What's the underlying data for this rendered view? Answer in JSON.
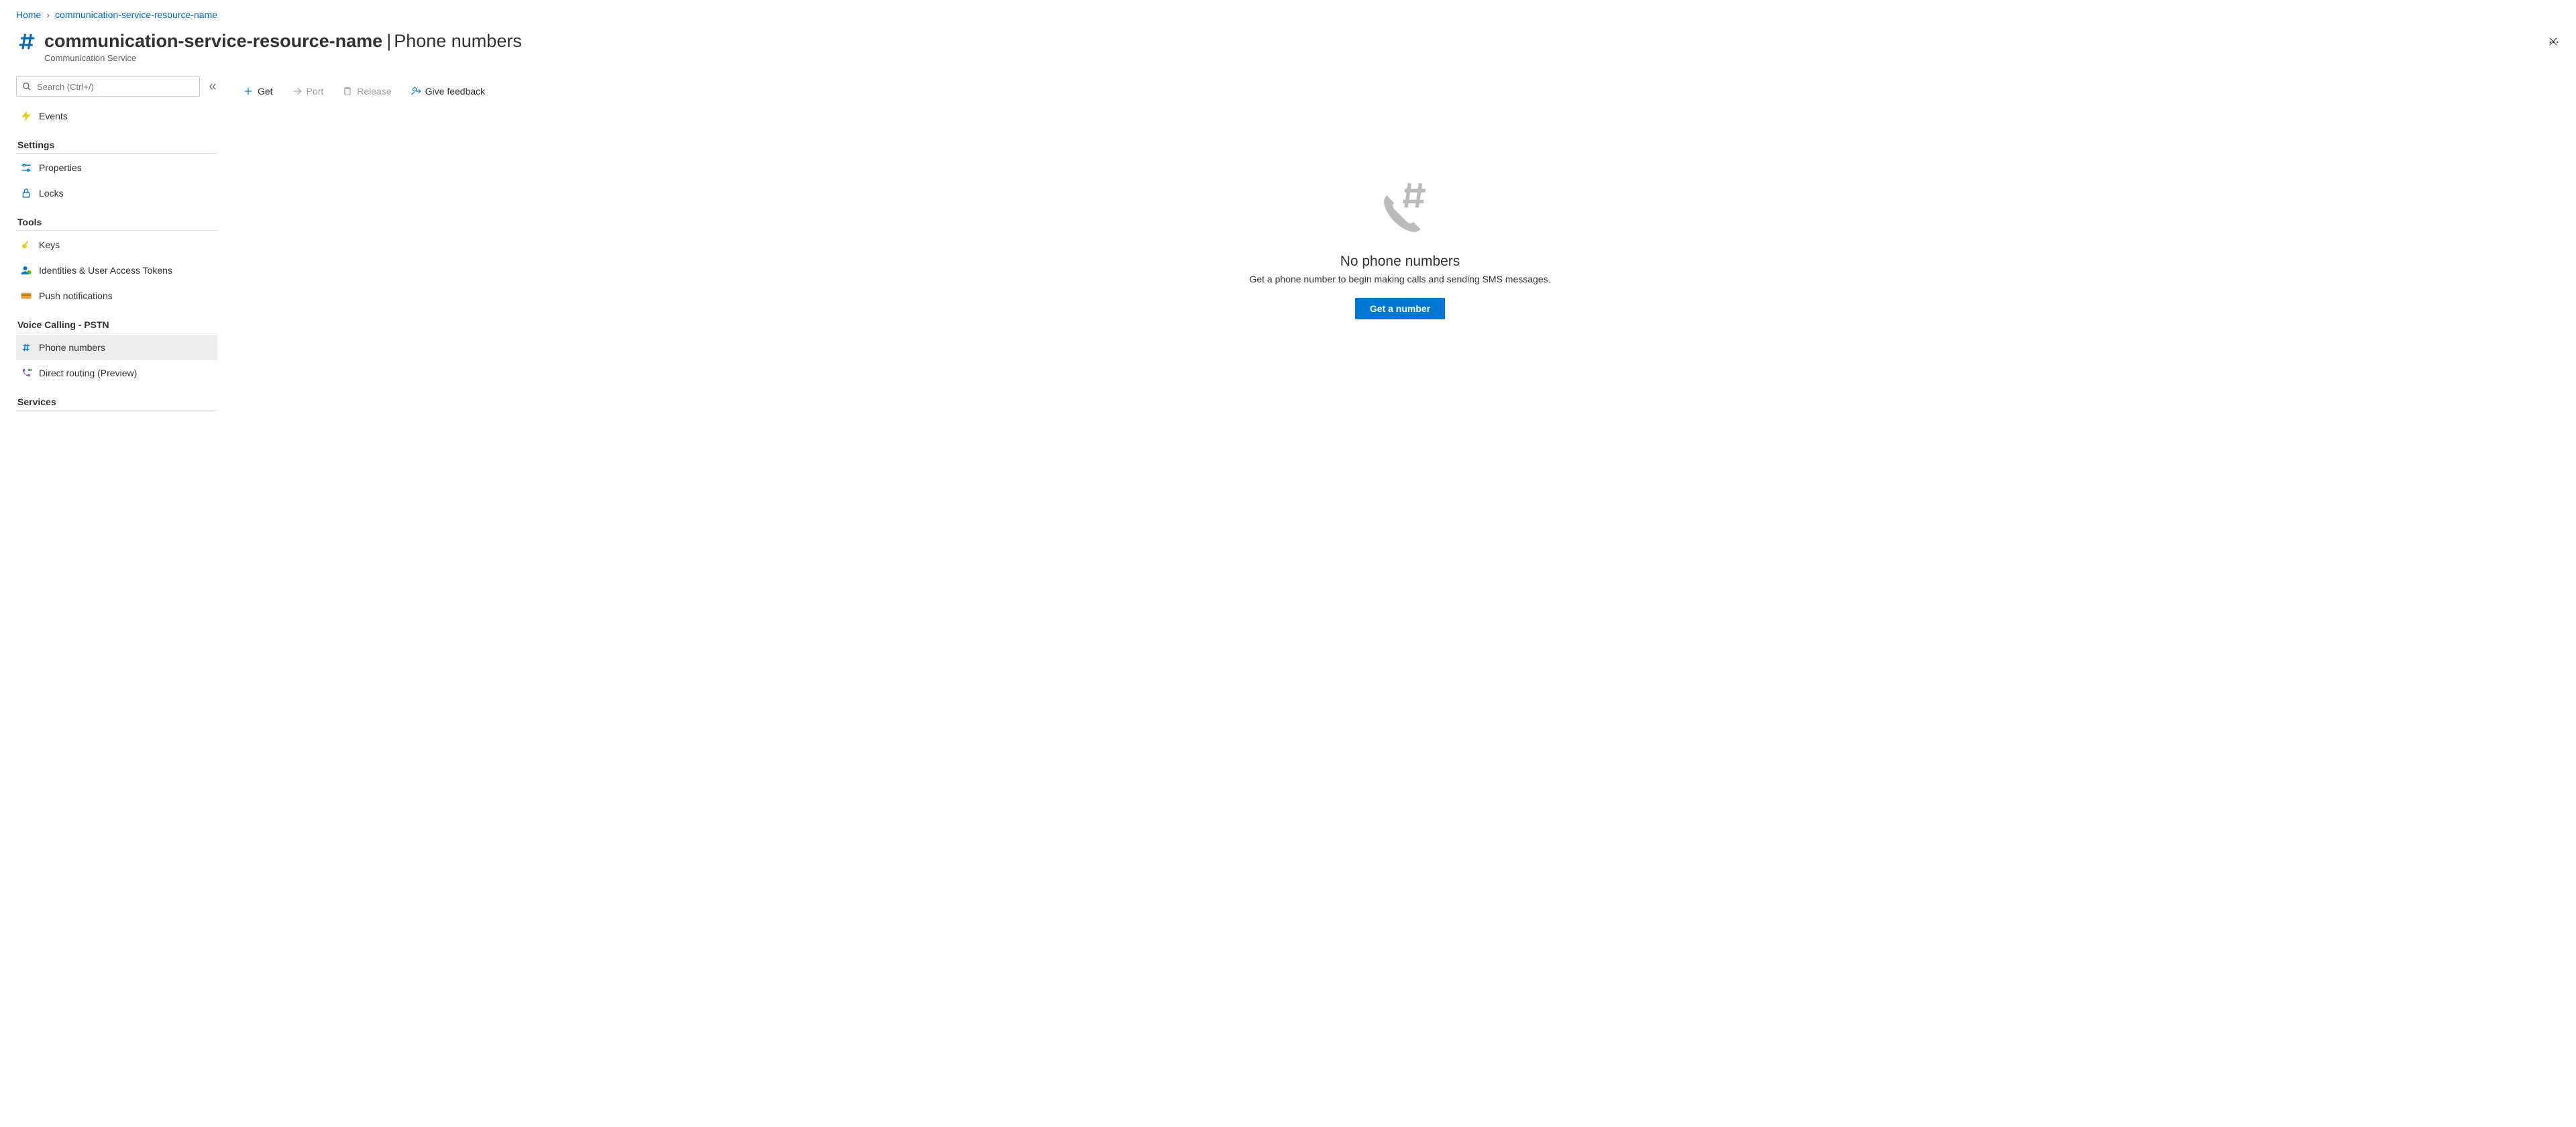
{
  "breadcrumbs": [
    {
      "label": "Home"
    },
    {
      "label": "communication-service-resource-name"
    }
  ],
  "header": {
    "resource": "communication-service-resource-name",
    "page": "Phone numbers",
    "subtitle": "Communication Service"
  },
  "search": {
    "placeholder": "Search (Ctrl+/)"
  },
  "nav": {
    "top": [
      {
        "id": "events",
        "label": "Events"
      }
    ],
    "groups": [
      {
        "title": "Settings",
        "items": [
          {
            "id": "properties",
            "label": "Properties"
          },
          {
            "id": "locks",
            "label": "Locks"
          }
        ]
      },
      {
        "title": "Tools",
        "items": [
          {
            "id": "keys",
            "label": "Keys"
          },
          {
            "id": "identities",
            "label": "Identities & User Access Tokens"
          },
          {
            "id": "push",
            "label": "Push notifications"
          }
        ]
      },
      {
        "title": "Voice Calling - PSTN",
        "items": [
          {
            "id": "phone-numbers",
            "label": "Phone numbers",
            "selected": true
          },
          {
            "id": "direct-routing",
            "label": "Direct routing (Preview)"
          }
        ]
      },
      {
        "title": "Services",
        "items": []
      }
    ]
  },
  "toolbar": {
    "get": "Get",
    "port": "Port",
    "release": "Release",
    "feedback": "Give feedback"
  },
  "empty": {
    "title": "No phone numbers",
    "subtitle": "Get a phone number to begin making calls and sending SMS messages.",
    "cta": "Get a number"
  }
}
